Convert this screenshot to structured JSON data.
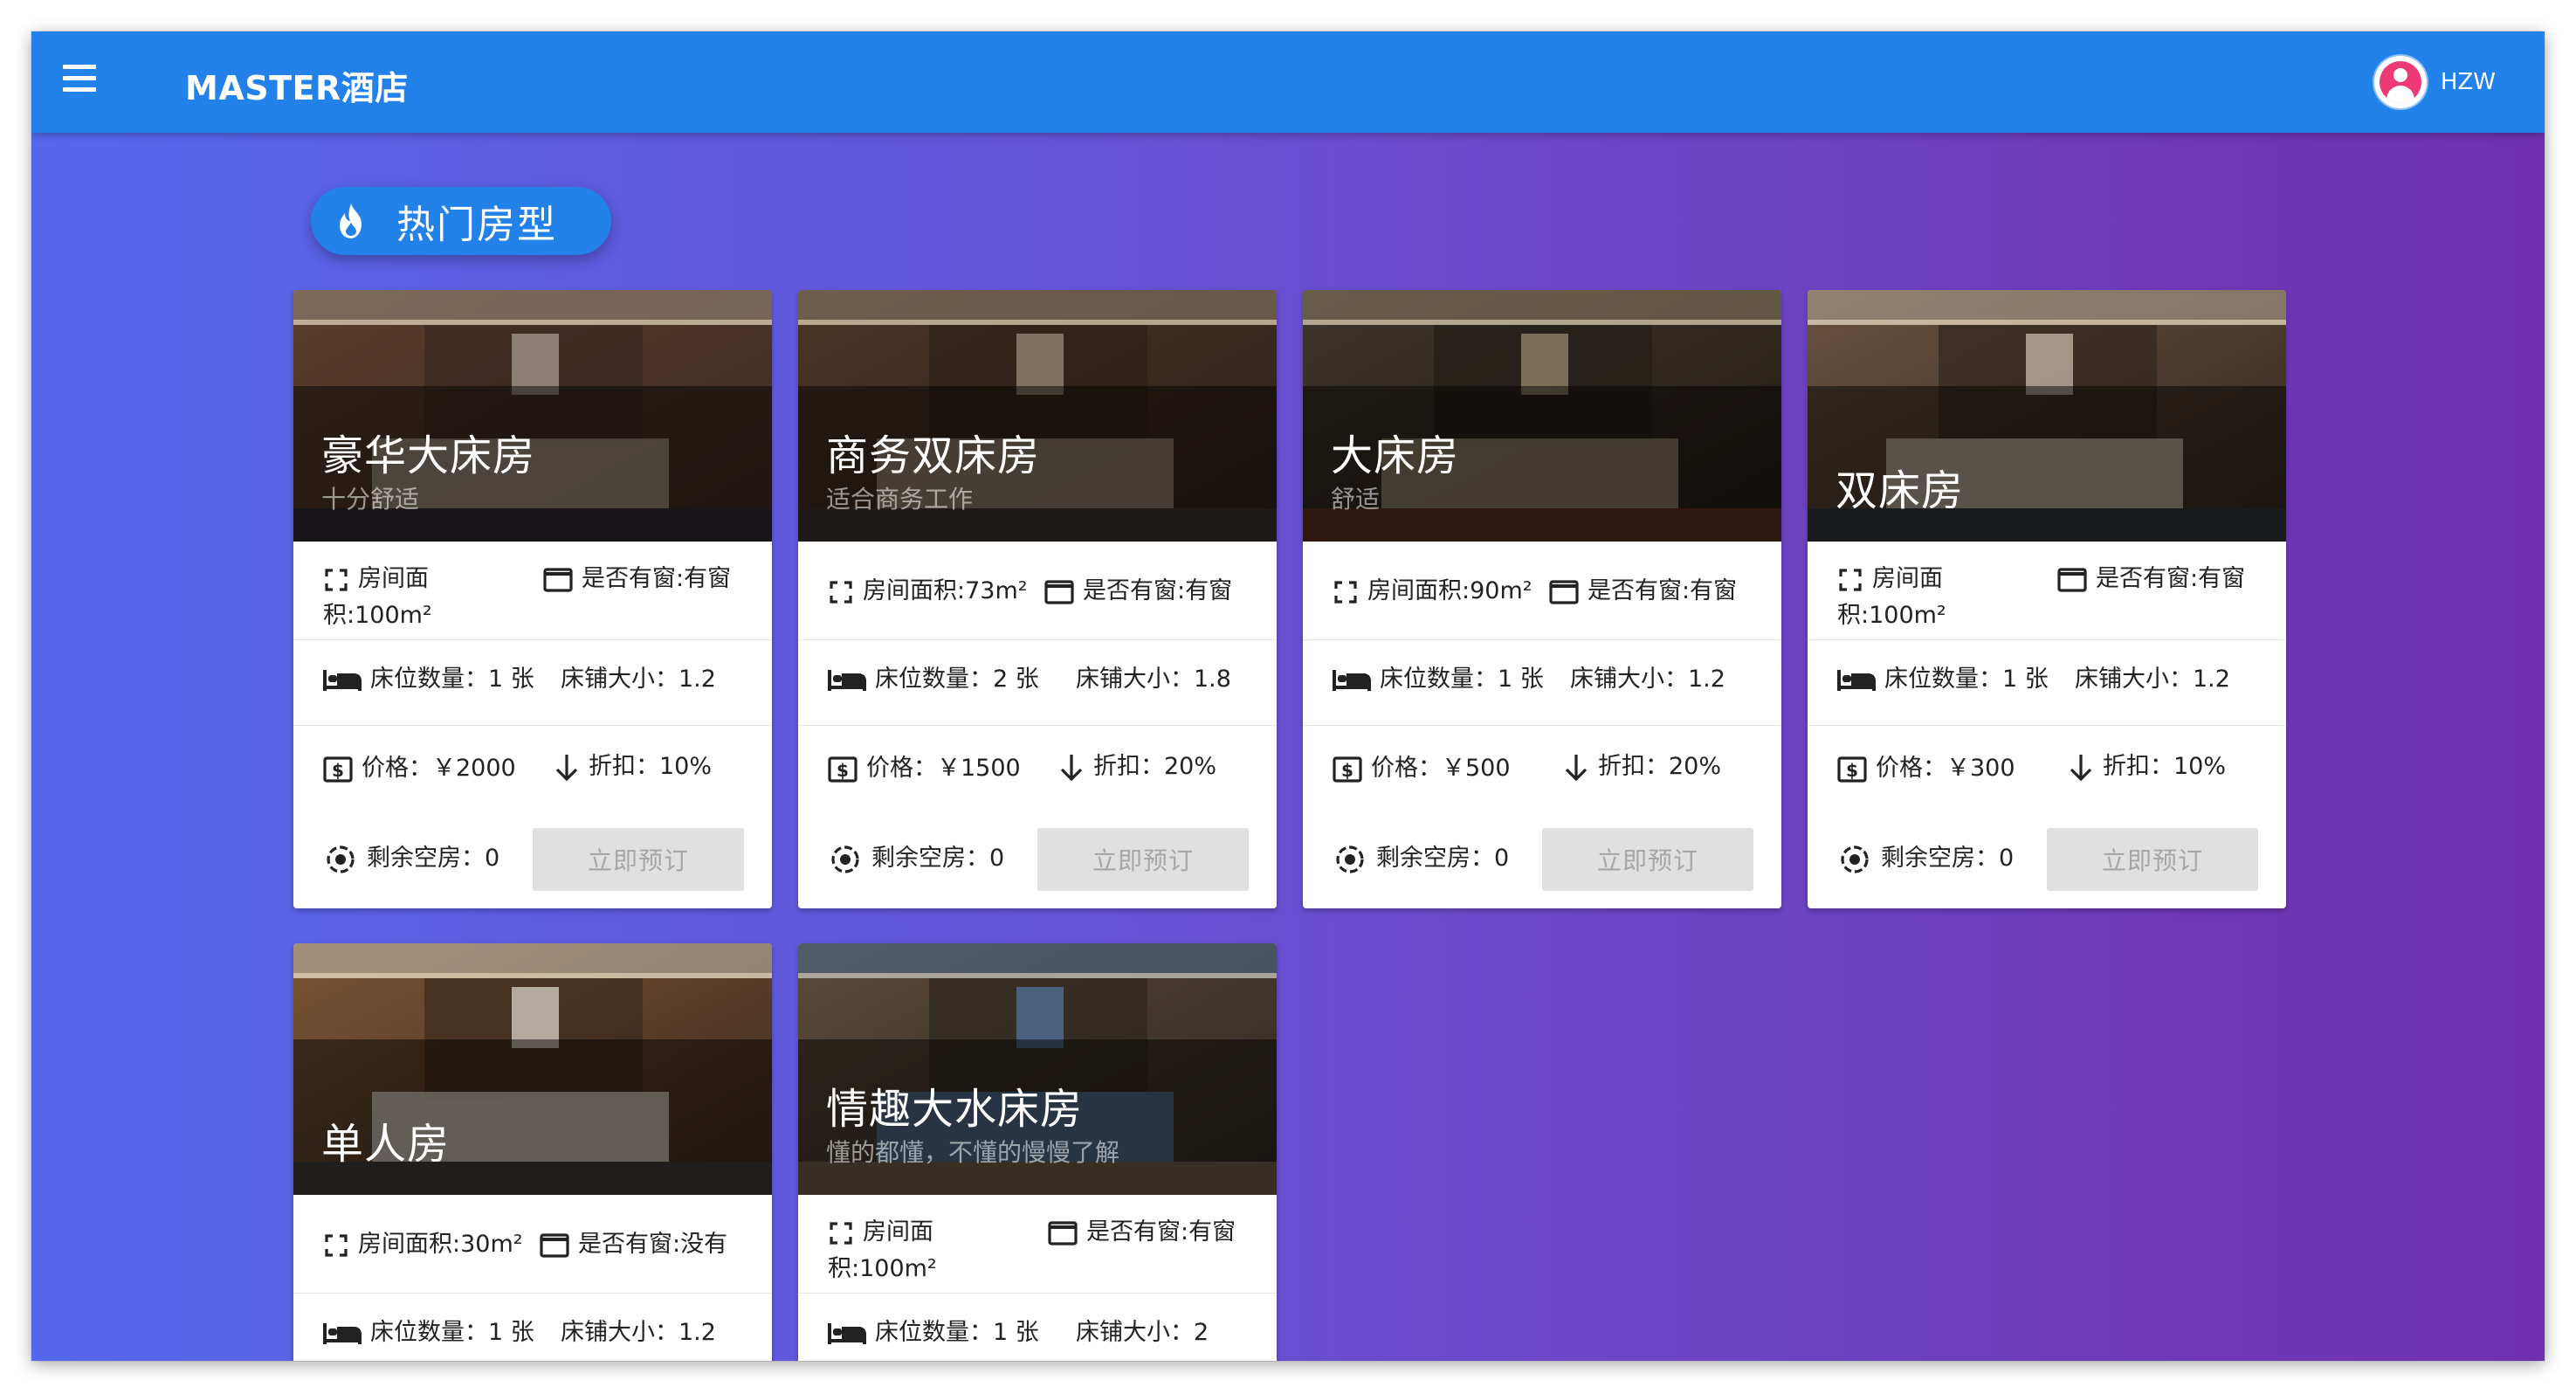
{
  "app": {
    "title": "MASTER酒店",
    "user": "HZW"
  },
  "section": {
    "title": "热门房型"
  },
  "labels": {
    "book": "立即预订"
  },
  "rooms": [
    {
      "title": "豪华大床房",
      "subtitle": "十分舒适",
      "area": "房间面积:100m²",
      "window": "是否有窗:有窗",
      "beds": "床位数量：1 张",
      "bed_size": "床铺大小：1.2",
      "price": "价格：￥2000",
      "discount": "折扣：10%",
      "remaining": "剩余空房：0"
    },
    {
      "title": "商务双床房",
      "subtitle": "适合商务工作",
      "area": "房间面积:73m²",
      "window": "是否有窗:有窗",
      "beds": "床位数量：2 张",
      "bed_size": "床铺大小：1.8",
      "price": "价格：￥1500",
      "discount": "折扣：20%",
      "remaining": "剩余空房：0"
    },
    {
      "title": "大床房",
      "subtitle": "舒适",
      "area": "房间面积:90m²",
      "window": "是否有窗:有窗",
      "beds": "床位数量：1 张",
      "bed_size": "床铺大小：1.2",
      "price": "价格：￥500",
      "discount": "折扣：20%",
      "remaining": "剩余空房：0"
    },
    {
      "title": "双床房",
      "subtitle": "",
      "area": "房间面积:100m²",
      "window": "是否有窗:有窗",
      "beds": "床位数量：1 张",
      "bed_size": "床铺大小：1.2",
      "price": "价格：￥300",
      "discount": "折扣：10%",
      "remaining": "剩余空房：0"
    },
    {
      "title": "单人房",
      "subtitle": "",
      "area": "房间面积:30m²",
      "window": "是否有窗:没有",
      "beds": "床位数量：1 张",
      "bed_size": "床铺大小：1.2"
    },
    {
      "title": "情趣大水床房",
      "subtitle": "懂的都懂，不懂的慢慢了解",
      "area": "房间面积:100m²",
      "window": "是否有窗:有窗",
      "beds": "床位数量：1 张",
      "bed_size": "床铺大小：2"
    }
  ],
  "icons": [
    "menu-icon",
    "account-icon",
    "fire-icon",
    "fullscreen-icon",
    "window-icon",
    "bed-icon",
    "dollar-icon",
    "arrow-down-icon",
    "target-icon"
  ],
  "colors": {
    "appbar": "#2381ea",
    "avatar": "#ec3a74",
    "gradient_start": "#5667ec",
    "gradient_end": "#7030ad"
  }
}
